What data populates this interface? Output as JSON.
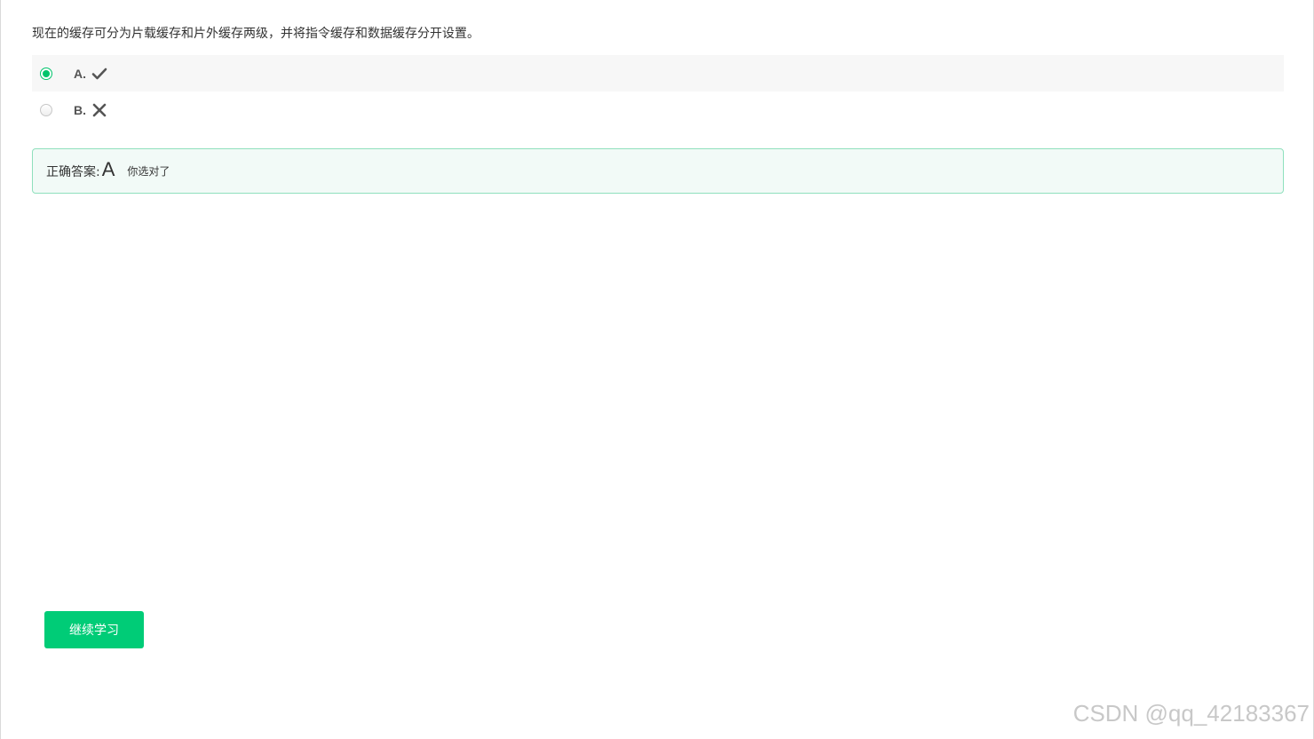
{
  "question": {
    "text": "现在的缓存可分为片载缓存和片外缓存两级，并将指令缓存和数据缓存分开设置。"
  },
  "options": [
    {
      "letter": "A.",
      "icon": "check-icon",
      "selected": true
    },
    {
      "letter": "B.",
      "icon": "cross-icon",
      "selected": false
    }
  ],
  "answer": {
    "label": "正确答案:",
    "value": "A",
    "result": "你选对了"
  },
  "actions": {
    "continue_label": "继续学习"
  },
  "watermark": {
    "text": "CSDN @qq_42183367"
  },
  "colors": {
    "accent": "#00cc77",
    "answer_border": "#8fe0bd",
    "answer_background": "#f2faf7",
    "selected_row": "#f7f7f7"
  }
}
